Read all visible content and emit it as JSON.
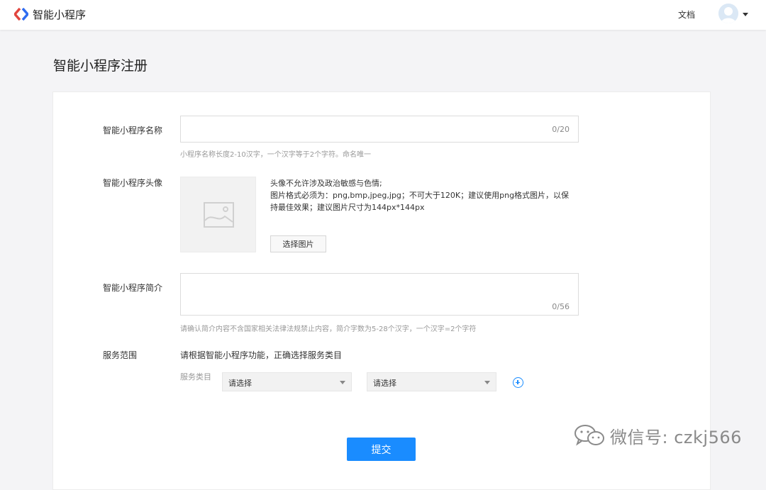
{
  "topbar": {
    "brand_name": "智能小程序",
    "docs_label": "文档"
  },
  "page": {
    "title": "智能小程序注册"
  },
  "form": {
    "name": {
      "label": "智能小程序名称",
      "counter": "0/20",
      "hint": "小程序名称长度2-10汉字，一个汉字等于2个字符。命名唯一"
    },
    "avatar": {
      "label": "智能小程序头像",
      "rules": [
        "头像不允许涉及政治敏感与色情;",
        "图片格式必须为：png,bmp,jpeg,jpg；不可大于120K；建议使用png格式图片，以保持最佳效果；建议图片尺寸为144px*144px"
      ],
      "choose_button": "选择图片"
    },
    "intro": {
      "label": "智能小程序简介",
      "counter": "0/56",
      "hint": "请确认简介内容不含国家相关法律法规禁止内容，简介字数为5-28个汉字，一个汉字=2个字符"
    },
    "service": {
      "label": "服务范围",
      "instruction": "请根据智能小程序功能，正确选择服务类目",
      "category_label": "服务类目",
      "select1": "请选择",
      "select2": "请选择"
    },
    "submit_label": "提交"
  },
  "watermark": {
    "text": "微信号: czkj566"
  },
  "colors": {
    "primary": "#1a8cff",
    "background": "#f4f4f6"
  }
}
